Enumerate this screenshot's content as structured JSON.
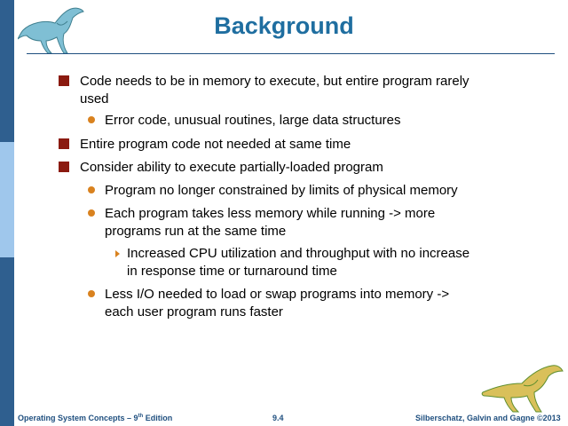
{
  "slide": {
    "title": "Background",
    "bullets": [
      {
        "level": 1,
        "text_line1": "Code needs to be in memory to execute, but entire program rarely",
        "text_line2": "used"
      },
      {
        "level": 2,
        "text_line1": "Error code, unusual routines, large data structures"
      },
      {
        "level": 1,
        "text_line1": "Entire program code not needed at same time"
      },
      {
        "level": 1,
        "text_line1": "Consider ability to execute partially-loaded program"
      },
      {
        "level": 2,
        "text_line1": "Program no longer constrained by limits of physical memory"
      },
      {
        "level": 2,
        "text_line1": "Each program takes less memory while running -> more",
        "text_line2": "programs run at the same time"
      },
      {
        "level": 3,
        "text_line1": "Increased CPU utilization and throughput with no increase",
        "text_line2": "in response time or turnaround time"
      },
      {
        "level": 2,
        "text_line1": "Less I/O needed to load or swap programs into memory ->",
        "text_line2": "each user program runs faster"
      }
    ]
  },
  "footer": {
    "left_prefix": "Operating System Concepts – 9",
    "left_sup": "th",
    "left_suffix": " Edition",
    "center": "9.4",
    "right": "Silberschatz, Galvin and Gagne ©2013"
  },
  "colors": {
    "title": "#1f6ea0",
    "level1_bullet": "#8b1a10",
    "level2_bullet": "#d9821f",
    "sidebar_dark": "#2f5f8f",
    "sidebar_light": "#9fc7ec"
  }
}
